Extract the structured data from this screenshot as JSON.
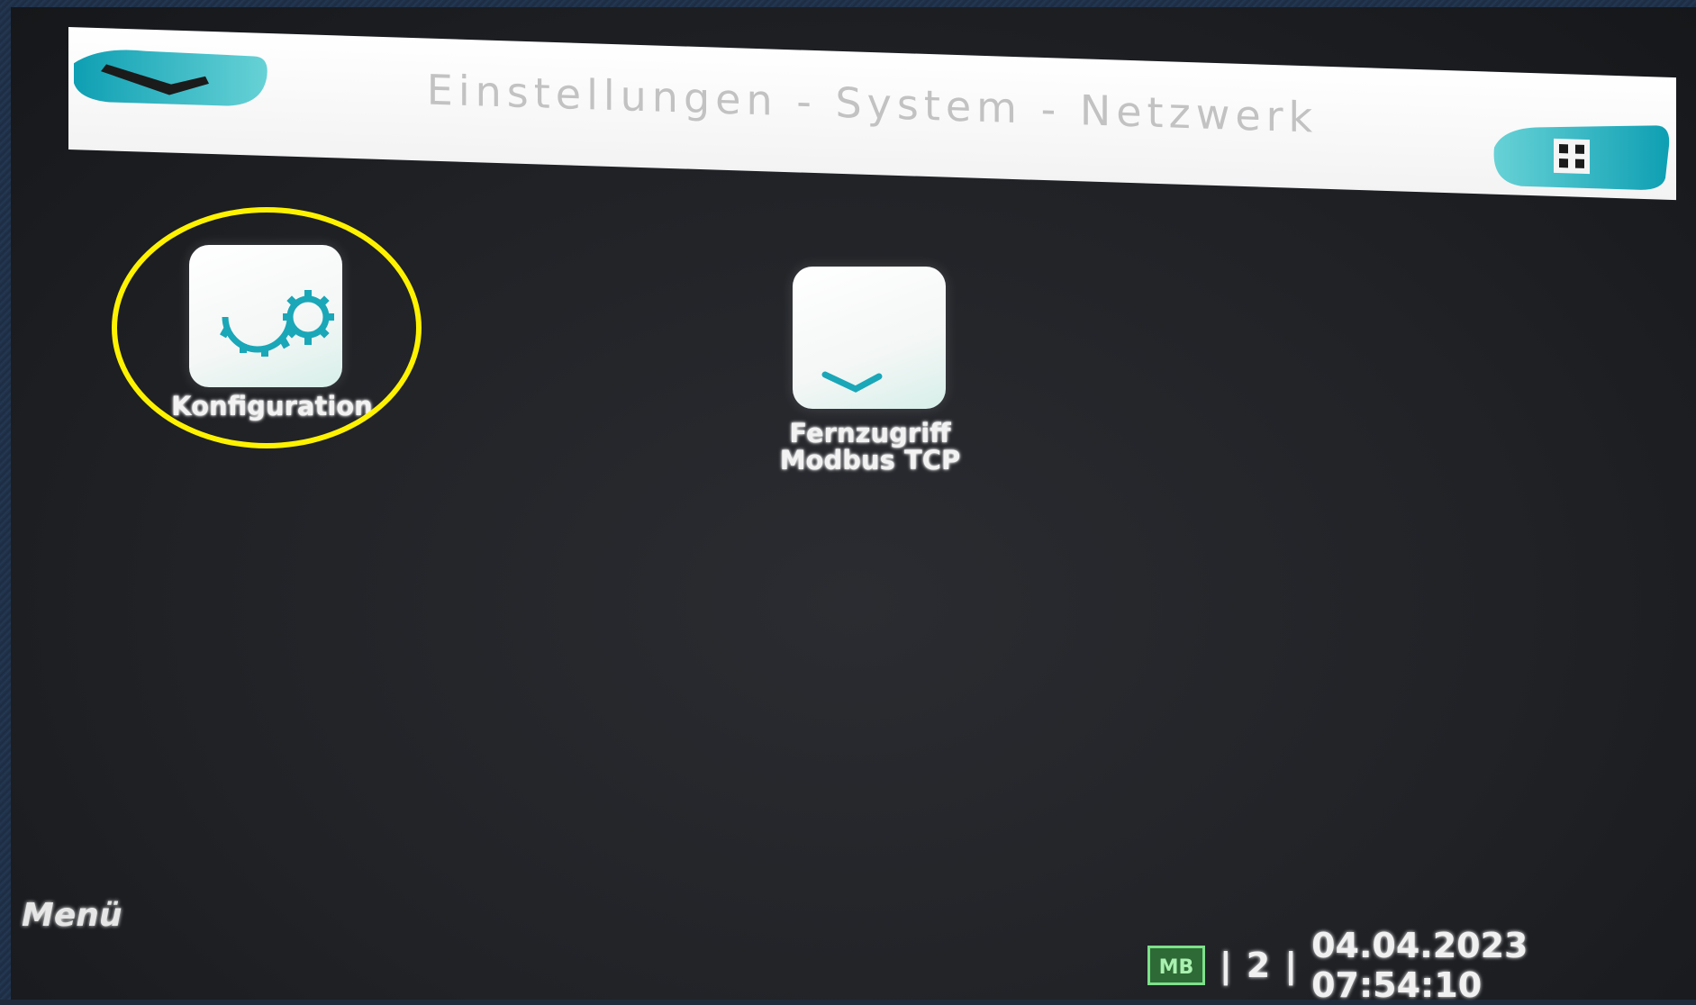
{
  "header": {
    "title": "Einstellungen - System - Netzwerk",
    "back_icon": "back-arrow-icon",
    "home_icon": "home-icon"
  },
  "tiles": [
    {
      "label": "Konfiguration",
      "icon": "gears-icon"
    },
    {
      "label_line1": "Fernzugriff",
      "label_line2": "Modbus TCP",
      "icon": "checkmark-icon"
    }
  ],
  "footer": {
    "menu_label": "Menü",
    "badge": "MB",
    "page": "2",
    "separator": "|",
    "datetime": "04.04.2023 07:54:10"
  },
  "colors": {
    "accent": "#1aa7b8",
    "highlight": "#fff200",
    "badge_border": "#7ee08a"
  }
}
